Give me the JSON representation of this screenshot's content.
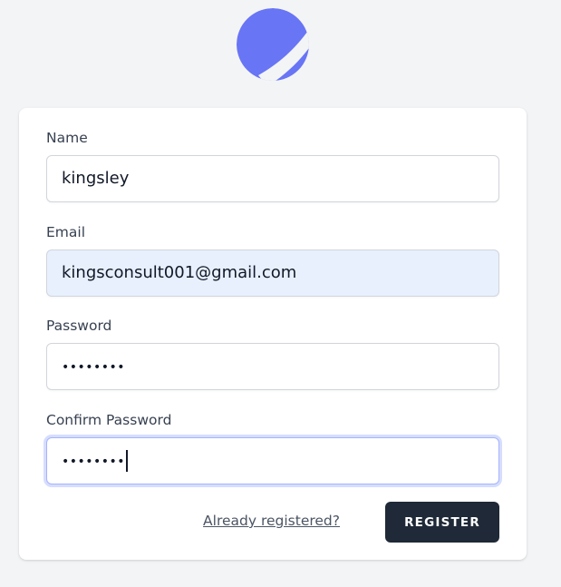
{
  "logo": {
    "icon": "app-logo-icon",
    "color": "#6875f5"
  },
  "form": {
    "name": {
      "label": "Name",
      "value": "kingsley"
    },
    "email": {
      "label": "Email",
      "value": "kingsconsult001@gmail.com"
    },
    "password": {
      "label": "Password",
      "value": "••••••••"
    },
    "confirm_password": {
      "label": "Confirm Password",
      "value": "••••••••"
    }
  },
  "actions": {
    "login_link": "Already registered?",
    "register_label": "REGISTER"
  }
}
